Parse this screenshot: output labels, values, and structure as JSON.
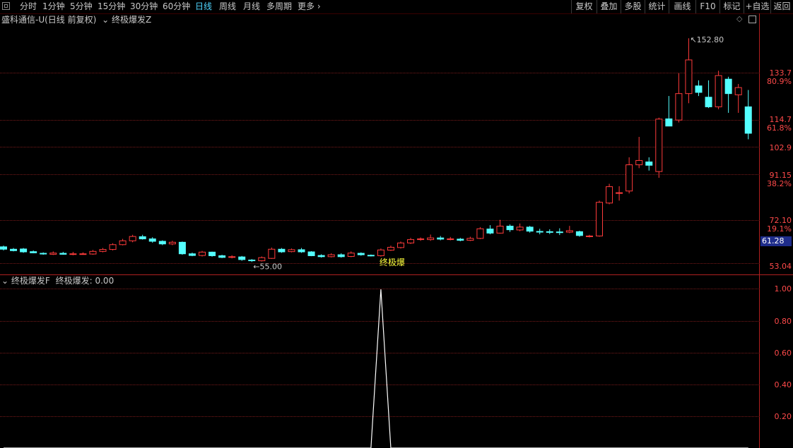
{
  "toolbar": {
    "periods": [
      "分时",
      "1分钟",
      "5分钟",
      "15分钟",
      "30分钟",
      "60分钟",
      "日线",
      "周线",
      "月线",
      "多周期",
      "更多"
    ],
    "active_period": "日线",
    "right_buttons": [
      "复权",
      "叠加",
      "多股",
      "统计",
      "画线",
      "F10",
      "标记",
      "+自选",
      "返回"
    ]
  },
  "main_panel": {
    "title": "盛科通信-U(日线 前复权)",
    "indicator_name": "终极爆发Z",
    "price_axis": [
      "133.7",
      "114.7",
      "102.9",
      "91.15",
      "72.10",
      "53.04"
    ],
    "pct_axis": [
      "80.9%",
      "61.8%",
      "38.2%",
      "19.1%"
    ],
    "current_price": "61.28",
    "high_label": "152.80",
    "low_label": "55.00",
    "signal_label": "终极爆"
  },
  "sub_panel": {
    "title": "终极爆发F",
    "value_label": "终极爆发: 0.00",
    "axis": [
      "1.00",
      "0.80",
      "0.60",
      "0.40",
      "0.20"
    ]
  },
  "colors": {
    "up": "#ff3b3b",
    "down": "#54ffff",
    "grid": "#7a1a1a",
    "axis": "#ff4a4a",
    "signal": "#ffff3c",
    "active": "#4fd6ff"
  },
  "chart_data": {
    "type": "candlestick",
    "price_range": [
      53.04,
      152.8
    ],
    "candles": [
      [
        61.3,
        60.3,
        61.8,
        59.8
      ],
      [
        60.3,
        59.7,
        60.8,
        59.4
      ],
      [
        60.4,
        59.2,
        60.8,
        58.8
      ],
      [
        59.3,
        58.8,
        59.8,
        58.6
      ],
      [
        58.6,
        58.4,
        59.0,
        58.0
      ],
      [
        58.2,
        58.7,
        59.4,
        57.9
      ],
      [
        58.6,
        58.2,
        59.2,
        58.0
      ],
      [
        58.3,
        58.4,
        59.2,
        57.8
      ],
      [
        58.2,
        58.4,
        59.0,
        58.0
      ],
      [
        58.3,
        59.4,
        60.0,
        58.0
      ],
      [
        59.4,
        60.2,
        60.8,
        59.0
      ],
      [
        60.2,
        62.2,
        62.8,
        59.8
      ],
      [
        62.2,
        63.8,
        64.6,
        61.9
      ],
      [
        63.8,
        65.6,
        66.3,
        63.2
      ],
      [
        65.5,
        64.6,
        66.3,
        64.3
      ],
      [
        64.6,
        63.6,
        65.3,
        63.0
      ],
      [
        63.6,
        62.5,
        64.0,
        62.0
      ],
      [
        62.5,
        63.2,
        63.8,
        62.0
      ],
      [
        63.2,
        58.4,
        63.5,
        58.0
      ],
      [
        58.4,
        57.7,
        58.9,
        57.4
      ],
      [
        57.7,
        59.1,
        59.6,
        57.3
      ],
      [
        59.1,
        57.6,
        59.3,
        57.2
      ],
      [
        57.6,
        56.9,
        58.0,
        56.6
      ],
      [
        56.9,
        57.2,
        57.8,
        56.5
      ],
      [
        57.1,
        56.0,
        57.5,
        55.5
      ],
      [
        55.8,
        55.5,
        56.2,
        55.0
      ],
      [
        55.5,
        56.8,
        57.3,
        55.2
      ],
      [
        56.5,
        60.3,
        61.0,
        56.3
      ],
      [
        60.3,
        59.2,
        60.8,
        58.8
      ],
      [
        59.3,
        60.1,
        60.6,
        59.0
      ],
      [
        60.1,
        59.2,
        60.8,
        58.8
      ],
      [
        59.2,
        57.6,
        59.5,
        57.4
      ],
      [
        57.7,
        57.2,
        58.2,
        56.8
      ],
      [
        57.2,
        58.0,
        58.6,
        56.9
      ],
      [
        58.0,
        57.2,
        58.6,
        56.8
      ],
      [
        57.3,
        58.7,
        59.4,
        57.0
      ],
      [
        58.6,
        58.0,
        59.0,
        57.6
      ],
      [
        57.8,
        57.6,
        58.1,
        57.3
      ],
      [
        57.6,
        60.0,
        60.6,
        57.2
      ],
      [
        59.9,
        61.1,
        61.8,
        59.6
      ],
      [
        61.0,
        62.9,
        63.5,
        60.6
      ],
      [
        62.9,
        64.3,
        65.0,
        62.5
      ],
      [
        64.3,
        64.6,
        65.2,
        63.8
      ],
      [
        64.3,
        65.0,
        66.4,
        63.8
      ],
      [
        65.0,
        64.5,
        65.8,
        64.0
      ],
      [
        64.5,
        64.6,
        65.4,
        64.0
      ],
      [
        64.5,
        64.0,
        65.0,
        63.6
      ],
      [
        64.0,
        64.8,
        65.5,
        63.7
      ],
      [
        64.8,
        68.8,
        69.5,
        64.5
      ],
      [
        68.7,
        67.0,
        70.3,
        66.5
      ],
      [
        67.0,
        69.9,
        72.5,
        66.8
      ],
      [
        69.9,
        68.4,
        70.6,
        67.5
      ],
      [
        68.3,
        69.5,
        71.0,
        67.8
      ],
      [
        69.5,
        67.8,
        70.0,
        67.2
      ],
      [
        67.7,
        67.6,
        68.8,
        66.5
      ],
      [
        67.6,
        67.5,
        68.6,
        66.6
      ],
      [
        67.5,
        67.2,
        69.0,
        66.2
      ],
      [
        67.4,
        68.0,
        70.0,
        67.0
      ],
      [
        67.6,
        66.0,
        68.0,
        65.5
      ],
      [
        65.6,
        65.8,
        66.3,
        65.2
      ],
      [
        65.8,
        79.8,
        80.5,
        65.5
      ],
      [
        79.5,
        86.3,
        87.5,
        79.0
      ],
      [
        83.8,
        83.8,
        86.5,
        80.5
      ],
      [
        84.5,
        95.4,
        98.5,
        83.5
      ],
      [
        95.4,
        97.2,
        107.0,
        94.0
      ],
      [
        96.6,
        95.2,
        98.5,
        93.0
      ],
      [
        92.6,
        114.4,
        115.0,
        90.0
      ],
      [
        114.5,
        111.5,
        124.0,
        112.0
      ],
      [
        114.0,
        125.0,
        133.5,
        113.0
      ],
      [
        125.0,
        139.0,
        148.0,
        121.0
      ],
      [
        128.2,
        125.5,
        130.5,
        124.0
      ],
      [
        123.5,
        119.5,
        130.5,
        119.0
      ],
      [
        119.5,
        132.5,
        134.5,
        118.5
      ],
      [
        131.0,
        125.0,
        132.0,
        117.0
      ],
      [
        124.5,
        127.5,
        129.0,
        117.0
      ],
      [
        119.5,
        108.5,
        126.5,
        106.0
      ]
    ],
    "indicator": {
      "name": "终极爆发",
      "range": [
        0,
        1
      ],
      "values": [
        0,
        0,
        0,
        0,
        0,
        0,
        0,
        0,
        0,
        0,
        0,
        0,
        0,
        0,
        0,
        0,
        0,
        0,
        0,
        0,
        0,
        0,
        0,
        0,
        0,
        0,
        0,
        0,
        0,
        0,
        0,
        0,
        0,
        0,
        0,
        0,
        0,
        0,
        1,
        0,
        0,
        0,
        0,
        0,
        0,
        0,
        0,
        0,
        0,
        0,
        0,
        0,
        0,
        0,
        0,
        0,
        0,
        0,
        0,
        0,
        0,
        0,
        0,
        0,
        0,
        0,
        0,
        0,
        0,
        0,
        0,
        0,
        0,
        0,
        0,
        0
      ]
    }
  }
}
